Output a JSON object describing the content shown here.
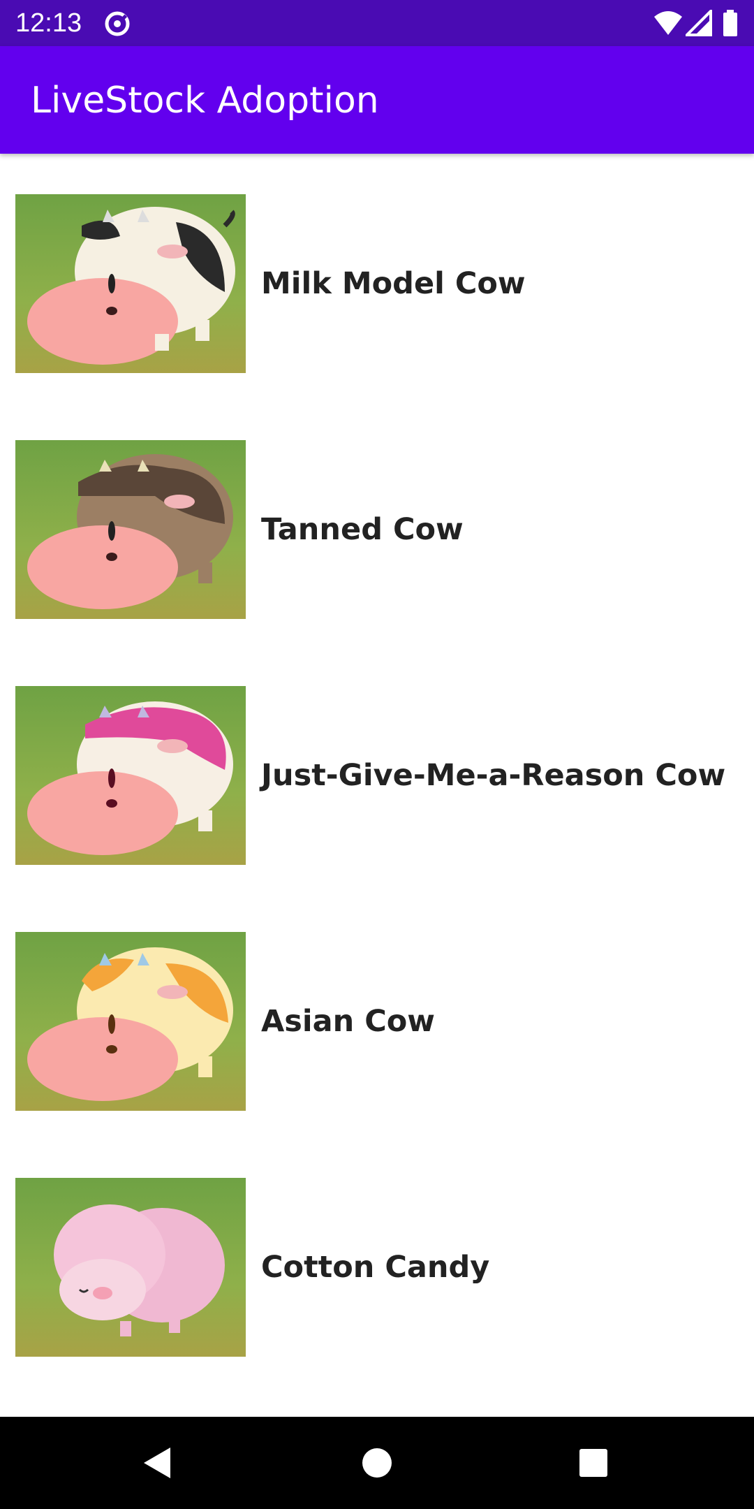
{
  "status_bar": {
    "time": "12:13",
    "icons": [
      "sync-icon",
      "wifi-icon",
      "signal-icon",
      "battery-icon"
    ]
  },
  "app_bar": {
    "title": "LiveStock Adoption"
  },
  "colors": {
    "status_bar": "#4a0bb3",
    "app_bar": "#6200ee",
    "text": "#222222"
  },
  "animals": [
    {
      "name": "Milk Model Cow",
      "image": "milk-model-cow-image"
    },
    {
      "name": "Tanned Cow",
      "image": "tanned-cow-image"
    },
    {
      "name": "Just-Give-Me-a-Reason Cow",
      "image": "just-give-me-a-reason-cow-image"
    },
    {
      "name": "Asian Cow",
      "image": "asian-cow-image"
    },
    {
      "name": "Cotton Candy",
      "image": "cotton-candy-sheep-image"
    }
  ],
  "nav_bar": {
    "buttons": [
      "back-icon",
      "home-icon",
      "recents-icon"
    ]
  }
}
